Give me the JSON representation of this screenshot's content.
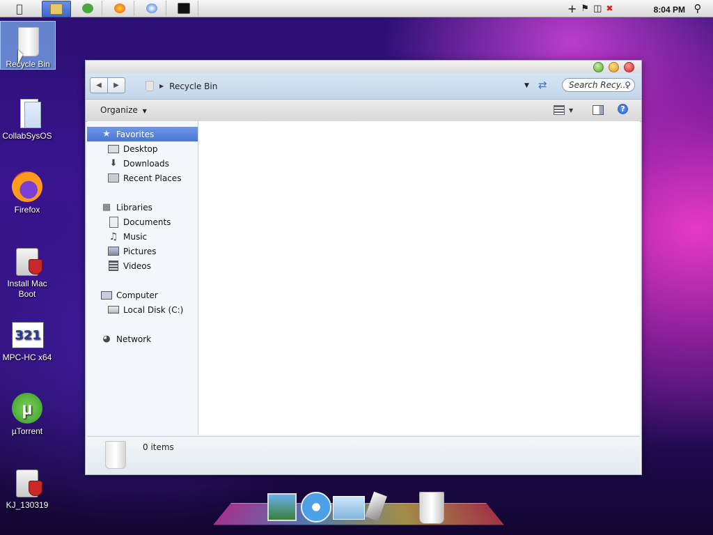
{
  "desktop": {
    "icons": [
      {
        "label": "Recycle Bin"
      },
      {
        "label": "CollabSysOS"
      },
      {
        "label": "Firefox"
      },
      {
        "label": "Install Mac Boot"
      },
      {
        "label": "MPC-HC x64"
      },
      {
        "label": "µTorrent"
      },
      {
        "label": "KJ_130319"
      }
    ]
  },
  "menubar": {
    "clock": "8:04 PM"
  },
  "window": {
    "breadcrumb": "Recycle Bin",
    "search_placeholder": "Search Recy...",
    "organize": "Organize",
    "sidebar": {
      "favorites": "Favorites",
      "desktop": "Desktop",
      "downloads": "Downloads",
      "recent": "Recent Places",
      "libraries": "Libraries",
      "documents": "Documents",
      "music": "Music",
      "pictures": "Pictures",
      "videos": "Videos",
      "computer": "Computer",
      "local_disk": "Local Disk (C:)",
      "network": "Network"
    },
    "status": "0 items"
  },
  "colors": {
    "selection": "#4a74d4",
    "accent_pink": "#f03cc8"
  }
}
